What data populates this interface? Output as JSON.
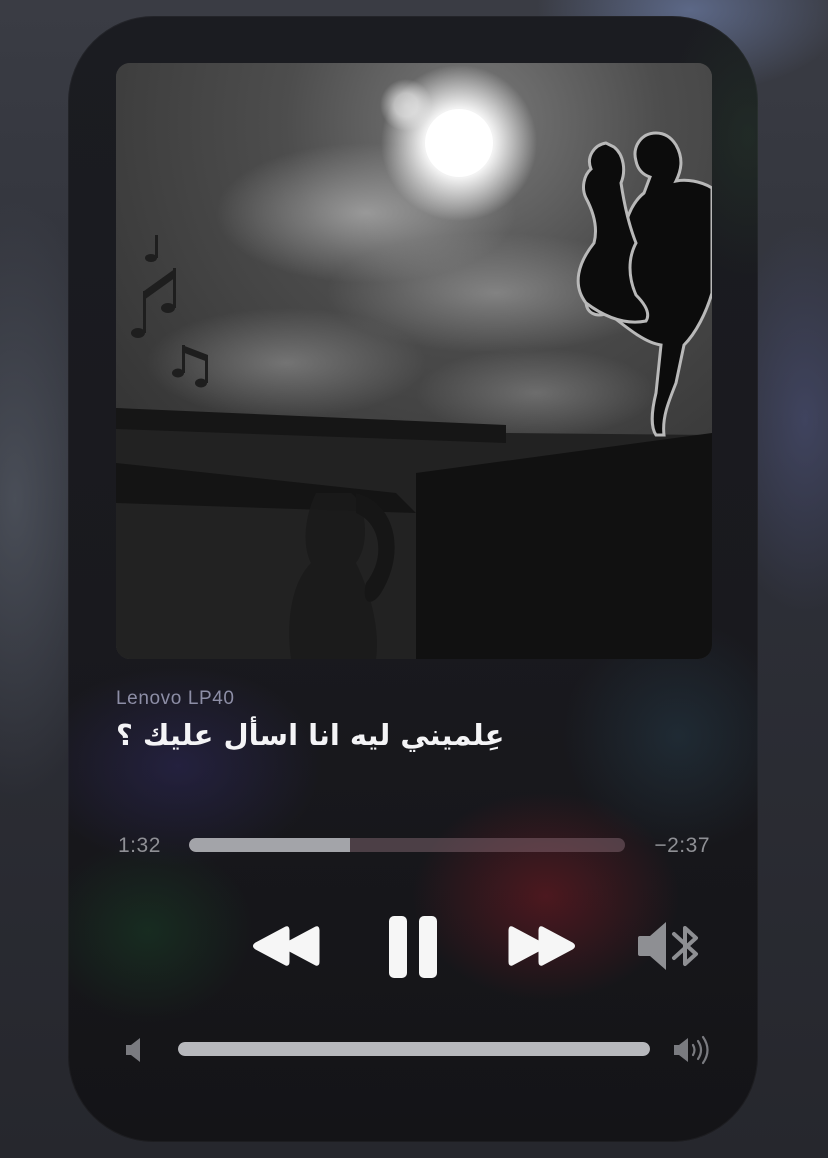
{
  "player": {
    "device_name": "Lenovo LP40",
    "song_title": "عِلميني ليه انا اسأل عليك ؟",
    "elapsed": "1:32",
    "remaining": "−2:37",
    "progress": 0.37,
    "volume": 1.0
  },
  "controls": {
    "rewind_icon": "rewind-icon",
    "pause_icon": "pause-icon",
    "forward_icon": "fast-forward-icon",
    "output_icon": "speaker-bluetooth-icon",
    "volume_low_icon": "volume-low-icon",
    "volume_high_icon": "volume-high-icon"
  },
  "colors": {
    "title": "#f4f4f6",
    "device_name": "#8d8ea6",
    "progress_fill": "#a3a4a9",
    "progress_track": "#6a5660"
  }
}
